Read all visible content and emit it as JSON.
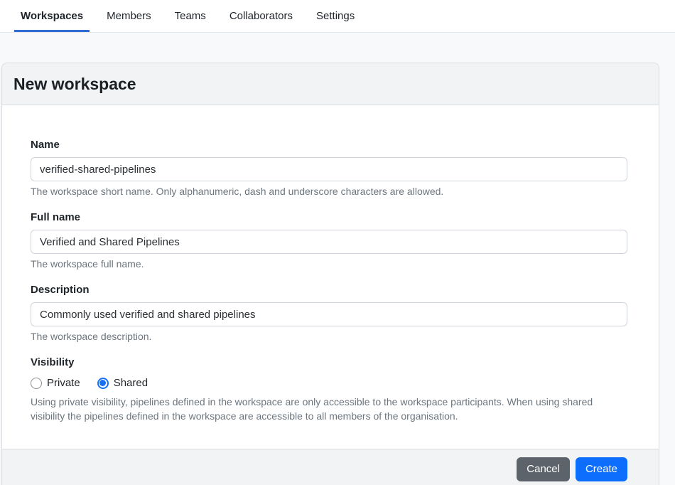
{
  "nav": {
    "tabs": [
      {
        "label": "Workspaces",
        "active": true
      },
      {
        "label": "Members",
        "active": false
      },
      {
        "label": "Teams",
        "active": false
      },
      {
        "label": "Collaborators",
        "active": false
      },
      {
        "label": "Settings",
        "active": false
      }
    ]
  },
  "panel": {
    "title": "New workspace",
    "fields": [
      {
        "label": "Name",
        "value": "verified-shared-pipelines",
        "help": "The workspace short name. Only alphanumeric, dash and underscore characters are allowed."
      },
      {
        "label": "Full name",
        "value": "Verified and Shared Pipelines",
        "help": "The workspace full name."
      },
      {
        "label": "Description",
        "value": "Commonly used verified and shared pipelines",
        "help": "The workspace description."
      }
    ],
    "visibility": {
      "label": "Visibility",
      "options": [
        {
          "label": "Private",
          "checked": false
        },
        {
          "label": "Shared",
          "checked": true
        }
      ],
      "help": "Using private visibility, pipelines defined in the workspace are only accessible to the workspace participants. When using shared visibility the pipelines defined in the workspace are accessible to all members of the organisation."
    },
    "footer": {
      "cancel_label": "Cancel",
      "create_label": "Create"
    }
  },
  "colors": {
    "tab_underline": "#2e6bd3",
    "radio_checked_blue": "#176ff3",
    "create_button_blue": "#0d6efd",
    "cancel_button_gray": "#5c636a",
    "helper_text_gray": "#6c757d",
    "panel_header_bg": "#f1f3f5",
    "page_bg": "#f8f9fa"
  }
}
